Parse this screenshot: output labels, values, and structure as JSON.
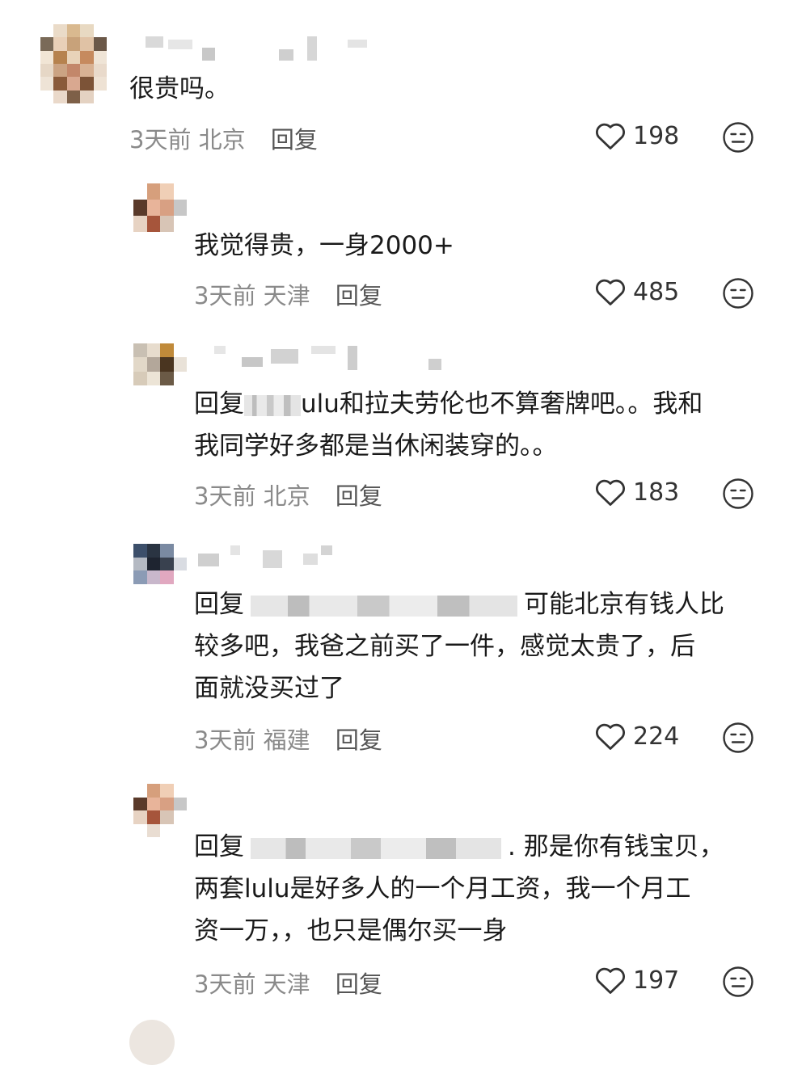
{
  "comments": [
    {
      "text": "很贵吗。",
      "time": "3天前",
      "location": "北京",
      "reply_label": "回复",
      "likes": "198"
    },
    {
      "text": "我觉得贵，一身2000+",
      "time": "3天前",
      "location": "天津",
      "reply_label": "回复",
      "likes": "485"
    },
    {
      "reply_prefix": "回复",
      "text_a": "ulu和拉夫劳伦也不算奢牌吧。。我和",
      "text_b": "我同学好多都是当休闲装穿的。。",
      "time": "3天前",
      "location": "北京",
      "reply_label": "回复",
      "likes": "183"
    },
    {
      "reply_prefix": "回复",
      "text_a": "可能北京有钱人比",
      "text_b": "较多吧，我爸之前买了一件，感觉太贵了，后",
      "text_c": "面就没买过了",
      "time": "3天前",
      "location": "福建",
      "reply_label": "回复",
      "likes": "224"
    },
    {
      "reply_prefix": "回复",
      "text_a": ". 那是你有钱宝贝，",
      "text_b": "两套lulu是好多人的一个月工资，我一个月工",
      "text_c": "资一万，，也只是偶尔买一身",
      "time": "3天前",
      "location": "天津",
      "reply_label": "回复",
      "likes": "197"
    }
  ],
  "icons": {
    "like": "heart-outline-icon",
    "dislike": "neutral-face-icon"
  },
  "colors": {
    "text": "#1a1a1a",
    "meta": "#8a8a8a",
    "icon": "#333333"
  }
}
